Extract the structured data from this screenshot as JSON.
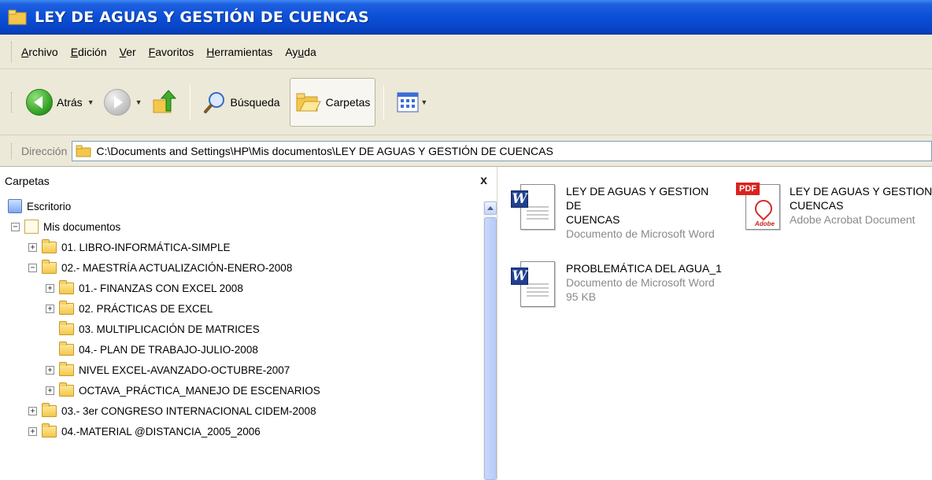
{
  "window": {
    "title": "LEY DE AGUAS Y GESTIÓN DE CUENCAS"
  },
  "menubar": {
    "items": [
      {
        "pre": "",
        "key": "A",
        "post": "rchivo"
      },
      {
        "pre": "",
        "key": "E",
        "post": "dición"
      },
      {
        "pre": "",
        "key": "V",
        "post": "er"
      },
      {
        "pre": "",
        "key": "F",
        "post": "avoritos"
      },
      {
        "pre": "",
        "key": "H",
        "post": "erramientas"
      },
      {
        "pre": "Ay",
        "key": "u",
        "post": "da"
      }
    ]
  },
  "toolbar": {
    "back_label": "Atrás",
    "search_label": "Búsqueda",
    "folders_label": "Carpetas"
  },
  "address": {
    "label": "Dirección",
    "path": "C:\\Documents and Settings\\HP\\Mis documentos\\LEY DE AGUAS Y GESTIÓN DE CUENCAS"
  },
  "folders_panel": {
    "title": "Carpetas",
    "close_glyph": "x",
    "tree": [
      {
        "label": "Escritorio"
      },
      {
        "label": "Mis documentos",
        "expander": "−"
      },
      {
        "label": "01. LIBRO-INFORMÁTICA-SIMPLE",
        "expander": "+"
      },
      {
        "label": "02.- MAESTRÍA ACTUALIZACIÓN-ENERO-2008",
        "expander": "−"
      },
      {
        "label": "01.- FINANZAS CON EXCEL 2008",
        "expander": "+"
      },
      {
        "label": "02. PRÁCTICAS DE EXCEL",
        "expander": "+"
      },
      {
        "label": "03. MULTIPLICACIÓN DE MATRICES"
      },
      {
        "label": "04.- PLAN DE TRABAJO-JULIO-2008"
      },
      {
        "label": "NIVEL EXCEL-AVANZADO-OCTUBRE-2007",
        "expander": "+"
      },
      {
        "label": "OCTAVA_PRÁCTICA_MANEJO DE ESCENARIOS",
        "expander": "+"
      },
      {
        "label": "03.- 3er CONGRESO INTERNACIONAL CIDEM-2008",
        "expander": "+"
      },
      {
        "label": "04.-MATERIAL @DISTANCIA_2005_2006",
        "expander": "+"
      }
    ]
  },
  "files": [
    {
      "name_line1": "LEY DE AGUAS Y GESTION DE",
      "name_line2": "CUENCAS",
      "type": "Documento de Microsoft Word",
      "icon": "word-doc-icon"
    },
    {
      "name_line1": "LEY DE AGUAS Y GESTION D",
      "name_line2": "CUENCAS",
      "type": "Adobe Acrobat Document",
      "icon": "pdf-doc-icon",
      "badge": "PDF",
      "brand": "Adobe"
    },
    {
      "name_line1": "PROBLEMÁTICA DEL AGUA_1",
      "type": "Documento de Microsoft Word",
      "size": "95 KB",
      "icon": "word-doc-icon"
    }
  ],
  "colors": {
    "titlebar": "#0a4fd6",
    "chrome": "#ece9d8",
    "folder": "#f3c74a",
    "word": "#21418f",
    "pdf": "#d9231f"
  }
}
